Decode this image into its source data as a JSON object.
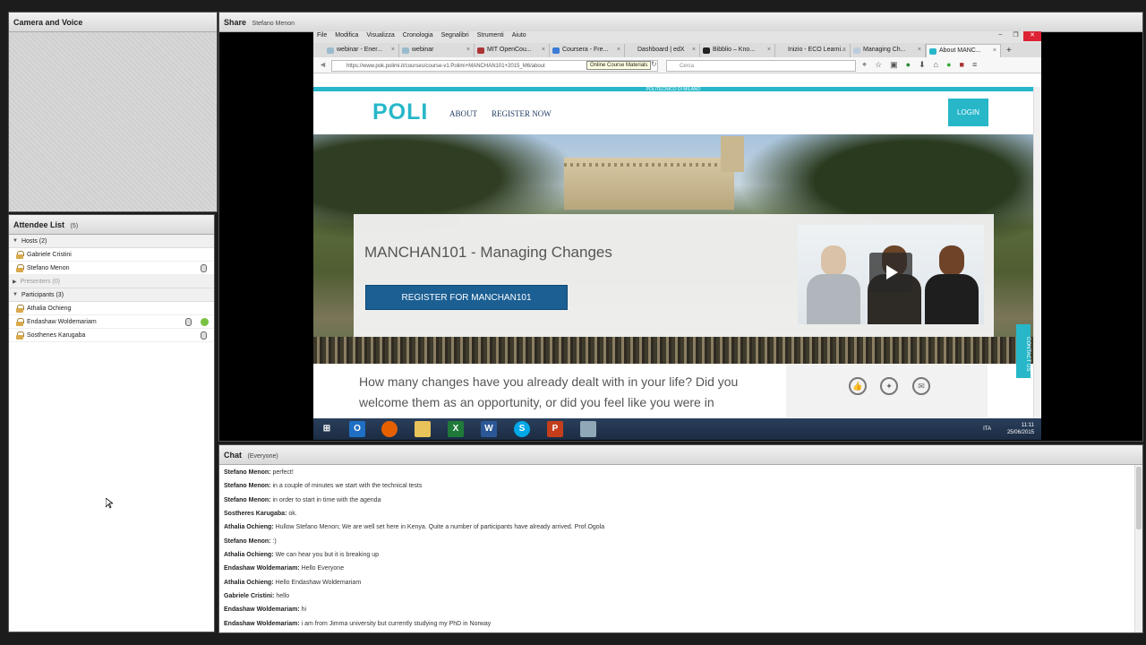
{
  "camera": {
    "title": "Camera and Voice"
  },
  "attendees": {
    "title": "Attendee List",
    "count": "(5)",
    "hosts_label": "Hosts (2)",
    "hosts": [
      "Gabriele Cristini",
      "Stefano Menon"
    ],
    "presenters_label": "Presenters (0)",
    "participants_label": "Participants (3)",
    "participants": [
      "Athalia Ochieng",
      "Endashaw Woldemariam",
      "Sosthenes Karugaba"
    ]
  },
  "share": {
    "title": "Share",
    "presenter": "Stefano Menon"
  },
  "browser": {
    "menu": [
      "File",
      "Modifica",
      "Visualizza",
      "Cronologia",
      "Segnalibri",
      "Strumenti",
      "Aiuto"
    ],
    "tabs": [
      "webinar - Ener...",
      "webinar",
      "MIT OpenCou...",
      "Coursera - Fre...",
      "Dashboard | edX",
      "Bibblio – Kno...",
      "Inizio - ECO Learni...",
      "Managing Ch...",
      "About MANC..."
    ],
    "url": "https://www.pok.polimi.it/courses/course-v1:Polimi+MANCHAN101+2015_M6/about",
    "tooltip": "Online Course Materials",
    "search_placeholder": "Cerca"
  },
  "site": {
    "topbar": "POLITECNICO DI MILANO",
    "logo": "POLI",
    "nav": [
      "ABOUT",
      "REGISTER NOW"
    ],
    "login": "LOGIN",
    "course_title": "MANCHAN101 - Managing Changes",
    "register_button": "REGISTER FOR MANCHAN101",
    "description": "How many changes have you already dealt with in your life? Did you welcome them as an opportunity, or did you feel like you were in",
    "contact_tab": "CONTACT US"
  },
  "taskbar": {
    "lang": "ITA",
    "time": "11:11",
    "date": "25/06/2015"
  },
  "chat": {
    "title": "Chat",
    "scope": "(Everyone)",
    "messages": [
      {
        "who": "Stefano Menon:",
        "text": "perfect!"
      },
      {
        "who": "Stefano Menon:",
        "text": "in a couple of minutes we start with the technical tests"
      },
      {
        "who": "Stefano Menon:",
        "text": "in order to start in time with the agenda"
      },
      {
        "who": "Sostheres Karugaba:",
        "text": "ok."
      },
      {
        "who": "Athalia Ochieng:",
        "text": "Hullow Stefano Menon; We are well set here in Kenya. Quite a number of participants have already arrived. Prof.Ogola"
      },
      {
        "who": "Stefano Menon:",
        "text": ":)"
      },
      {
        "who": "Athalia Ochieng:",
        "text": "We can hear you but it is breaking up"
      },
      {
        "who": "Endashaw Woldemariam:",
        "text": "Hello Everyone"
      },
      {
        "who": "Athalia Ochieng:",
        "text": "Hello Endashaw Woldemariam"
      },
      {
        "who": "Gabriele Cristini:",
        "text": "hello"
      },
      {
        "who": "Endashaw Woldemariam:",
        "text": "hi"
      },
      {
        "who": "Endashaw Woldemariam:",
        "text": "i am from Jimma university but currently studying my PhD in Norway"
      }
    ]
  }
}
